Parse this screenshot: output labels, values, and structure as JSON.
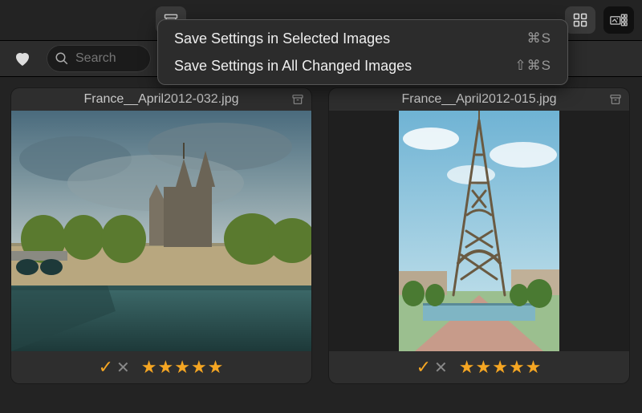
{
  "toolbar": {
    "archive_icon": "archive-icon",
    "grid_icon": "grid-icon",
    "compare_icon": "compare-icon"
  },
  "filter": {
    "heart_icon": "heart-icon",
    "search_icon": "search-icon",
    "search_placeholder": "Search",
    "search_value": ""
  },
  "menu": {
    "items": [
      {
        "label": "Save Settings in Selected Images",
        "shortcut": "⌘S"
      },
      {
        "label": "Save Settings in All Changed Images",
        "shortcut": "⇧⌘S"
      }
    ]
  },
  "gallery": [
    {
      "filename": "France__April2012-032.jpg",
      "selected": true,
      "orientation": "landscape",
      "pick_state": "picked",
      "rating": 5
    },
    {
      "filename": "France__April2012-015.jpg",
      "selected": false,
      "orientation": "portrait",
      "pick_state": "picked",
      "rating": 5
    }
  ],
  "colors": {
    "accent": "#f5a623",
    "bg": "#232323",
    "panel": "#2e2e2e"
  }
}
